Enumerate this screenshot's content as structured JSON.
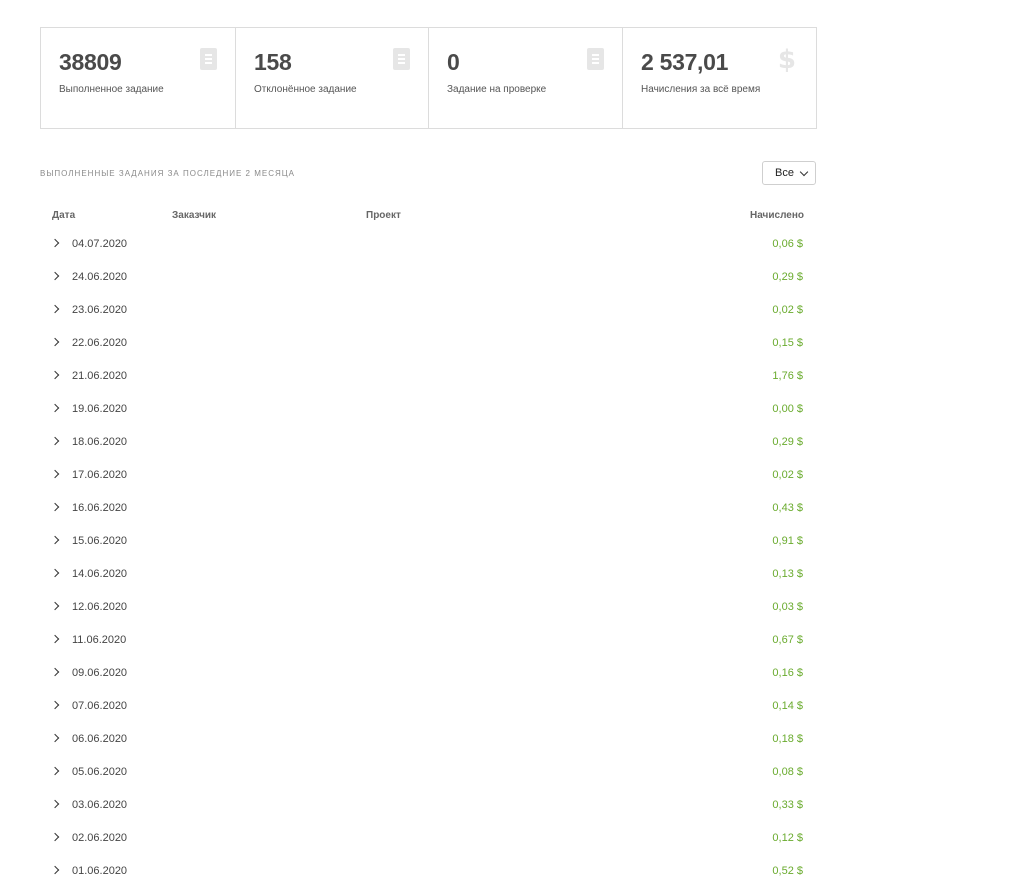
{
  "stats": [
    {
      "value": "38809",
      "label": "Выполненное задание",
      "icon": "document-icon"
    },
    {
      "value": "158",
      "label": "Отклонённое задание",
      "icon": "document-icon"
    },
    {
      "value": "0",
      "label": "Задание на проверке",
      "icon": "document-icon"
    },
    {
      "value": "2 537,01",
      "label": "Начисления за всё время",
      "icon": "dollar-icon"
    }
  ],
  "section": {
    "title": "Выполненные задания за последние 2 месяца",
    "filter_value": "Все"
  },
  "table": {
    "headers": {
      "date": "Дата",
      "customer": "Заказчик",
      "project": "Проект",
      "amount": "Начислено"
    },
    "rows": [
      {
        "date": "04.07.2020",
        "amount": "0,06 $"
      },
      {
        "date": "24.06.2020",
        "amount": "0,29 $"
      },
      {
        "date": "23.06.2020",
        "amount": "0,02 $"
      },
      {
        "date": "22.06.2020",
        "amount": "0,15 $"
      },
      {
        "date": "21.06.2020",
        "amount": "1,76 $"
      },
      {
        "date": "19.06.2020",
        "amount": "0,00 $"
      },
      {
        "date": "18.06.2020",
        "amount": "0,29 $"
      },
      {
        "date": "17.06.2020",
        "amount": "0,02 $"
      },
      {
        "date": "16.06.2020",
        "amount": "0,43 $"
      },
      {
        "date": "15.06.2020",
        "amount": "0,91 $"
      },
      {
        "date": "14.06.2020",
        "amount": "0,13 $"
      },
      {
        "date": "12.06.2020",
        "amount": "0,03 $"
      },
      {
        "date": "11.06.2020",
        "amount": "0,67 $"
      },
      {
        "date": "09.06.2020",
        "amount": "0,16 $"
      },
      {
        "date": "07.06.2020",
        "amount": "0,14 $"
      },
      {
        "date": "06.06.2020",
        "amount": "0,18 $"
      },
      {
        "date": "05.06.2020",
        "amount": "0,08 $"
      },
      {
        "date": "03.06.2020",
        "amount": "0,33 $"
      },
      {
        "date": "02.06.2020",
        "amount": "0,12 $"
      },
      {
        "date": "01.06.2020",
        "amount": "0,52 $"
      }
    ]
  },
  "colors": {
    "amount": "#6aab2e",
    "border": "#dcdcdc",
    "icon": "#e6e6e6"
  }
}
